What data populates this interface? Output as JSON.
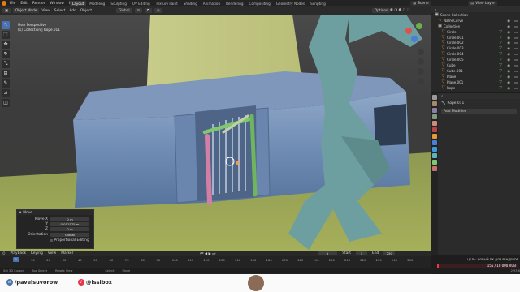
{
  "menu": [
    "File",
    "Edit",
    "Render",
    "Window",
    "Help"
  ],
  "workspaces": [
    "Layout",
    "Modeling",
    "Sculpting",
    "UV Editing",
    "Texture Paint",
    "Shading",
    "Animation",
    "Rendering",
    "Compositing",
    "Geometry Nodes",
    "Scripting"
  ],
  "top_right": {
    "scene_label": "Scene",
    "view_layer_label": "View Layer"
  },
  "viewport_header": {
    "mode": "Object Mode",
    "view": "View",
    "select": "Select",
    "add": "Add",
    "object": "Object",
    "orientation": "Global",
    "options": "Options"
  },
  "viewport_info": {
    "line1": "User Perspective",
    "line2": "(1) Collection | Rope.011"
  },
  "toolbar_icons": [
    "cursor-icon",
    "select-box-icon",
    "move-icon",
    "rotate-icon",
    "scale-icon",
    "transform-icon",
    "annotate-icon",
    "measure-icon",
    "add-cube-icon"
  ],
  "outliner": {
    "title": "Scene Collection",
    "items": [
      {
        "name": "NameCurve"
      },
      {
        "name": "Collection"
      },
      {
        "name": "Circle"
      },
      {
        "name": "Circle.001"
      },
      {
        "name": "Circle.002"
      },
      {
        "name": "Circle.003"
      },
      {
        "name": "Circle.004"
      },
      {
        "name": "Circle.005"
      },
      {
        "name": "Cube"
      },
      {
        "name": "Cube.001"
      },
      {
        "name": "Plane"
      },
      {
        "name": "Plane.001"
      },
      {
        "name": "Rope"
      }
    ]
  },
  "properties": {
    "object_name": "Rope.011",
    "add_modifier": "Add Modifier"
  },
  "operator_panel": {
    "title": "Move",
    "move_x_label": "Move X",
    "move_x_value": "0 m",
    "y_label": "Y",
    "y_value": "0.011575 m",
    "z_label": "Z",
    "z_value": "0 m",
    "orientation_label": "Orientation",
    "orientation_value": "Global",
    "proportional_label": "Proportional Editing"
  },
  "timeline": {
    "menus": [
      "Playback",
      "Keying",
      "View",
      "Marker"
    ],
    "current_frame": "1",
    "ticks": [
      "10",
      "20",
      "30",
      "40",
      "50",
      "60",
      "70",
      "80",
      "90",
      "100",
      "110",
      "120",
      "130",
      "140",
      "150",
      "160",
      "170",
      "180",
      "190",
      "200",
      "210",
      "220",
      "230",
      "240",
      "250"
    ],
    "start_label": "Start",
    "start_value": "1",
    "end_label": "End",
    "end_value": "250"
  },
  "statusbar": {
    "select": "Set 3D Cursor",
    "box": "Box Select",
    "rotate": "Rotate View",
    "select2": "Select",
    "move": "Move",
    "version": "2.93.6"
  },
  "social": {
    "vk_handle": "/pavelsuvorow",
    "tiktok_handle": "@issibox",
    "donate_title": "ЦЕЛЬ: НОВЫЙ ПК ДЛЯ РЕНДЕРОВ",
    "donate_amount": "155 / 10 000 RUB"
  },
  "colors": {
    "accent": "#4772b3",
    "donate_accent": "#e8364a",
    "vk_blue": "#4a76a8"
  }
}
